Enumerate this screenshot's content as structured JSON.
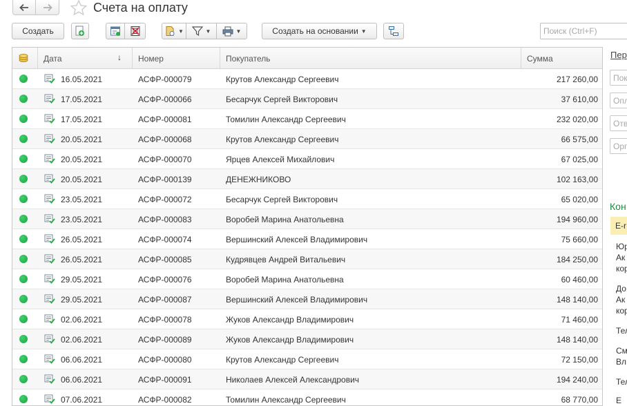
{
  "window": {
    "title": "Счета на оплату",
    "nav_back_icon": "arrow-left-icon",
    "nav_forward_icon": "arrow-right-icon",
    "favorite_icon": "star-icon"
  },
  "toolbar": {
    "create_label": "Создать",
    "create_based_on_label": "Создать на основании",
    "search_placeholder": "Поиск (Ctrl+F)"
  },
  "table": {
    "columns": {
      "date": "Дата",
      "number": "Номер",
      "buyer": "Покупатель",
      "sum": "Сумма"
    },
    "sort_indicator": "↓",
    "rows": [
      {
        "date": "16.05.2021",
        "number": "АСФР-000079",
        "buyer": "Крутов Александр Сергеевич",
        "sum": "217 260,00"
      },
      {
        "date": "17.05.2021",
        "number": "АСФР-000066",
        "buyer": "Бесарчук Сергей Викторович",
        "sum": "37 610,00"
      },
      {
        "date": "17.05.2021",
        "number": "АСФР-000081",
        "buyer": "Томилин Александр Сергеевич",
        "sum": "232 020,00"
      },
      {
        "date": "20.05.2021",
        "number": "АСФР-000068",
        "buyer": "Крутов Александр Сергеевич",
        "sum": "66 575,00"
      },
      {
        "date": "20.05.2021",
        "number": "АСФР-000070",
        "buyer": "Ярцев Алексей Михайлович",
        "sum": "67 025,00"
      },
      {
        "date": "20.05.2021",
        "number": "АСФР-000139",
        "buyer": "ДЕНЕЖНИКОВО",
        "sum": "102 163,00"
      },
      {
        "date": "23.05.2021",
        "number": "АСФР-000072",
        "buyer": "Бесарчук Сергей Викторович",
        "sum": "65 020,00"
      },
      {
        "date": "23.05.2021",
        "number": "АСФР-000083",
        "buyer": "Воробей Марина Анатольевна",
        "sum": "194 960,00"
      },
      {
        "date": "26.05.2021",
        "number": "АСФР-000074",
        "buyer": "Вершинский Алексей Владимирович",
        "sum": "75 660,00"
      },
      {
        "date": "26.05.2021",
        "number": "АСФР-000085",
        "buyer": "Кудрявцев Андрей Витальевич",
        "sum": "184 250,00"
      },
      {
        "date": "29.05.2021",
        "number": "АСФР-000076",
        "buyer": "Воробей Марина Анатольевна",
        "sum": "60 460,00"
      },
      {
        "date": "29.05.2021",
        "number": "АСФР-000087",
        "buyer": "Вершинский Алексей Владимирович",
        "sum": "148 140,00"
      },
      {
        "date": "02.06.2021",
        "number": "АСФР-000078",
        "buyer": "Жуков Александр Владимирович",
        "sum": "71 460,00"
      },
      {
        "date": "02.06.2021",
        "number": "АСФР-000089",
        "buyer": "Жуков Александр Владимирович",
        "sum": "148 140,00"
      },
      {
        "date": "06.06.2021",
        "number": "АСФР-000080",
        "buyer": "Крутов Александр Сергеевич",
        "sum": "72 150,00"
      },
      {
        "date": "06.06.2021",
        "number": "АСФР-000091",
        "buyer": "Николаев Алексей Александрович",
        "sum": "194 240,00"
      },
      {
        "date": "07.06.2021",
        "number": "АСФР-000082",
        "buyer": "Томилин Александр Сергеевич",
        "sum": "68 770,00"
      }
    ]
  },
  "right_panel": {
    "link": "Пер",
    "field_placeholders": [
      "Пок",
      "Опл",
      "Отв",
      "Орг"
    ],
    "section_title": "Кон",
    "highlighted_item": "E-r",
    "text_lines": [
      "Юр",
      "Ак",
      "кор",
      "До",
      "Ак",
      "кор",
      "Тел",
      "См",
      "Вл",
      "Тел",
      "Е"
    ]
  },
  "colors": {
    "status_green": "#22b04b",
    "section_green": "#1c8b3c",
    "highlight_yellow": "#fbeeb3"
  }
}
